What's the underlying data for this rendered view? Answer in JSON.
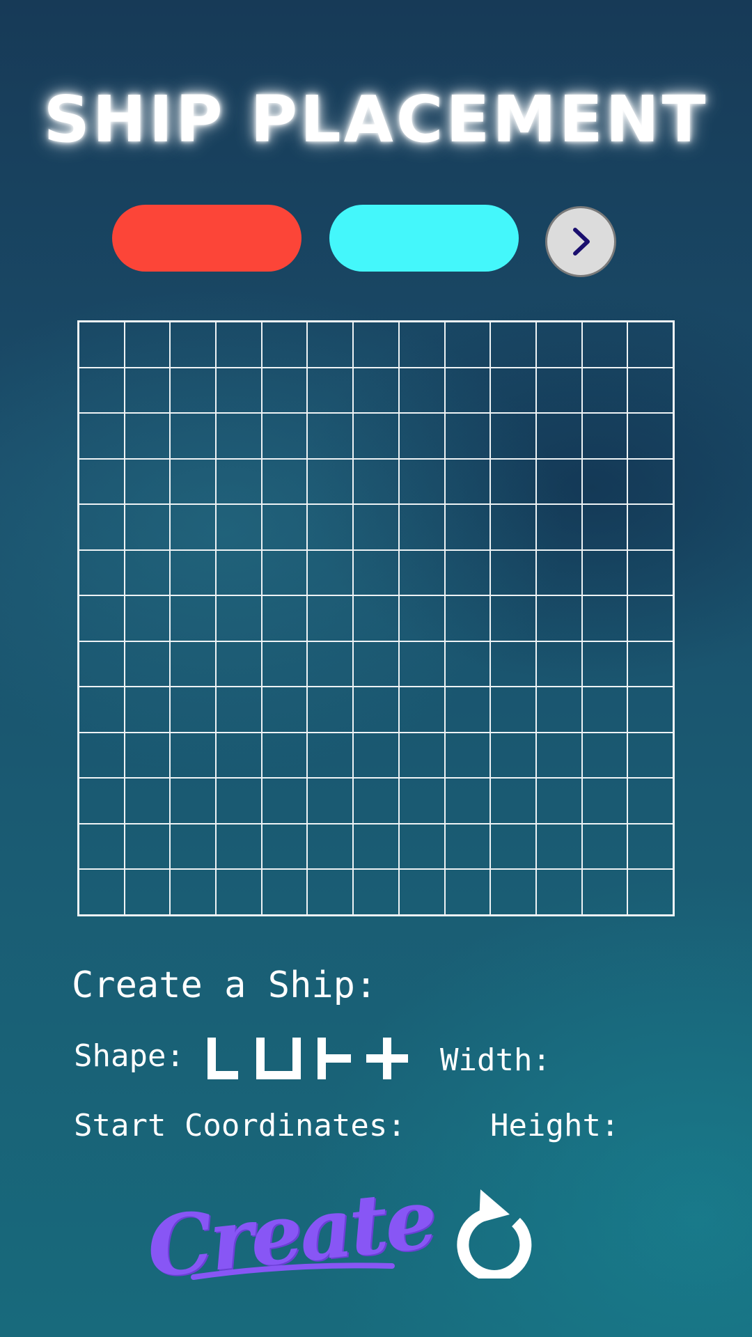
{
  "title": "SHIP PLACEMENT",
  "colors": {
    "player_one": "#fc4538",
    "player_two": "#44f7fb",
    "create_accent": "#8856f5",
    "grid_line": "#eef3f5"
  },
  "next_icon": "chevron-right-icon",
  "grid": {
    "rows": 13,
    "cols": 13
  },
  "create_ship": {
    "heading": "Create a Ship:",
    "shape_label": "Shape:",
    "shape_options": [
      "L-shape",
      "U-shape",
      "T-shape",
      "Cross-shape"
    ],
    "width_label": "Width:",
    "start_coordinates_label": "Start Coordinates:",
    "height_label": "Height:"
  },
  "create_button_label": "Create",
  "reset_icon": "refresh-icon"
}
